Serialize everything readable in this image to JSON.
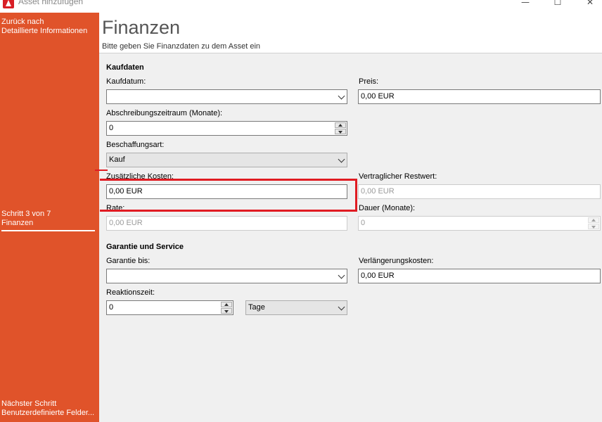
{
  "window": {
    "title": "Asset hinzufügen",
    "minimize_glyph": "—",
    "maximize_glyph": "☐",
    "close_glyph": "✕"
  },
  "sidebar": {
    "back_line1": "Zurück nach",
    "back_line2": "Detaillierte Informationen",
    "step_line1": "Schritt 3 von 7",
    "step_line2": "Finanzen",
    "next_line1": "Nächster Schritt",
    "next_line2": "Benutzerdefinierte Felder..."
  },
  "header": {
    "title": "Finanzen",
    "subtitle": "Bitte geben Sie Finanzdaten zu dem Asset ein"
  },
  "kaufdaten": {
    "section_title": "Kaufdaten",
    "kaufdatum_label": "Kaufdatum:",
    "kaufdatum_value": "",
    "preis_label": "Preis:",
    "preis_value": "0,00 EUR",
    "abschreibung_label": "Abschreibungszeitraum (Monate):",
    "abschreibung_value": "0",
    "beschaffungsart_label": "Beschaffungsart:",
    "beschaffungsart_value": "Kauf",
    "zusaetzliche_kosten_label": "Zusätzliche Kosten:",
    "zusaetzliche_kosten_value": "0,00 EUR",
    "restwert_label": "Vertraglicher Restwert:",
    "restwert_value": "0,00 EUR",
    "rate_label": "Rate:",
    "rate_value": "0,00 EUR",
    "dauer_label": "Dauer (Monate):",
    "dauer_value": "0"
  },
  "garantie": {
    "section_title": "Garantie und Service",
    "garantie_bis_label": "Garantie bis:",
    "garantie_bis_value": "",
    "verlaengerung_label": "Verlängerungskosten:",
    "verlaengerung_value": "0,00 EUR",
    "reaktionszeit_label": "Reaktionszeit:",
    "reaktionszeit_value": "0",
    "reaktionszeit_unit": "Tage"
  },
  "colors": {
    "sidebar_bg": "#e0532a",
    "highlight": "#e01b22",
    "form_bg": "#f0f0f0"
  },
  "icons": [
    "app-logo-icon",
    "chevron-down-icon",
    "spin-up-icon",
    "spin-down-icon"
  ]
}
